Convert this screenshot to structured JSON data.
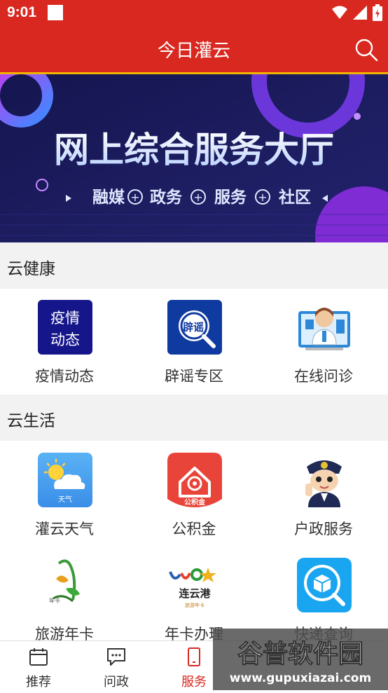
{
  "status_bar": {
    "time": "9:01"
  },
  "header": {
    "title": "今日灌云"
  },
  "banner": {
    "headline": "网上综合服务大厅",
    "tags": [
      "融媒",
      "政务",
      "服务",
      "社区"
    ]
  },
  "sections": [
    {
      "title": "云健康",
      "items": [
        {
          "label": "疫情动态",
          "icon_text": "疫情动态"
        },
        {
          "label": "辟谣专区",
          "icon_text": "辟谣"
        },
        {
          "label": "在线问诊"
        }
      ]
    },
    {
      "title": "云生活",
      "items": [
        {
          "label": "灌云天气",
          "icon_text": "天气"
        },
        {
          "label": "公积金",
          "icon_text": "公积金"
        },
        {
          "label": "户政服务"
        },
        {
          "label": "旅游年卡"
        },
        {
          "label": "年卡办理",
          "icon_text": "连云港"
        },
        {
          "label": "快递查询"
        }
      ]
    }
  ],
  "bottom_nav": [
    {
      "label": "推荐"
    },
    {
      "label": "问政"
    },
    {
      "label": "服务"
    },
    {
      "label": ""
    },
    {
      "label": ""
    }
  ],
  "watermark": {
    "text": "谷普软件园",
    "url": "www.gupuxiazai.com"
  },
  "colors": {
    "primary": "#d8281f",
    "accent": "#f0b400",
    "banner_bg": "#1a1a5e"
  }
}
